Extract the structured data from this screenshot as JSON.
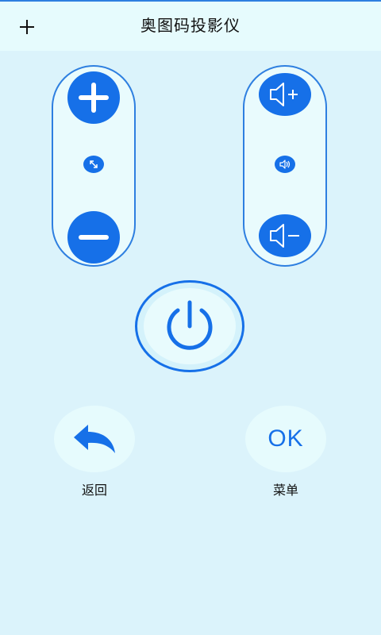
{
  "header": {
    "title": "奥图码投影仪",
    "add_icon": "plus-icon"
  },
  "zoom_panel": {
    "zoom_in_icon": "plus-icon",
    "center_icon": "expand-arrows-icon",
    "zoom_out_icon": "minus-icon"
  },
  "volume_panel": {
    "volume_up_icon": "speaker-plus-icon",
    "center_icon": "speaker-icon",
    "volume_down_icon": "speaker-minus-icon"
  },
  "power": {
    "icon": "power-icon"
  },
  "controls": {
    "back_label": "返回",
    "back_icon": "reply-arrow-icon",
    "ok_text": "OK",
    "menu_label": "菜单"
  },
  "colors": {
    "accent": "#1670e8",
    "background": "#dbf3fb",
    "header_background": "#e6fbfd"
  }
}
